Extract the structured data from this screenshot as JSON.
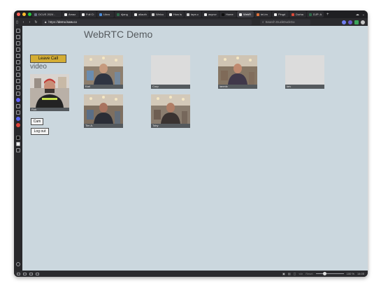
{
  "browser": {
    "tabs": [
      {
        "label": "DCUS 2024 -",
        "color": "#6a6f84",
        "active": false
      },
      {
        "label": "Amaz",
        "color": "#f0f0f0",
        "active": false
      },
      {
        "label": "Full Ci",
        "color": "#f0f0f0",
        "active": false
      },
      {
        "label": "Libra",
        "color": "#4a8ad6",
        "active": false
      },
      {
        "label": "djang",
        "color": "#2f6a4a",
        "active": false
      },
      {
        "label": "allauth",
        "color": "#f0f0f0",
        "active": false
      },
      {
        "label": "Welco",
        "color": "#cfcfcf",
        "active": false
      },
      {
        "label": "How is",
        "color": "#f0f0f0",
        "active": false
      },
      {
        "label": "tape-c",
        "color": "#cfcfcf",
        "active": false
      },
      {
        "label": "asyncr",
        "color": "#f0f0f0",
        "active": false
      },
      {
        "label": "Home",
        "color": "#111111",
        "active": false
      },
      {
        "label": "WebR",
        "color": "#f0f0f0",
        "active": true
      },
      {
        "label": "tel-im",
        "color": "#e0713a",
        "active": false
      },
      {
        "label": "Pingd",
        "color": "#f0f0f0",
        "active": false
      },
      {
        "label": "Durha",
        "color": "#d84a3a",
        "active": false
      },
      {
        "label": "DJP: A",
        "color": "#2f6a4a",
        "active": false
      }
    ],
    "new_tab": "+",
    "url_prefix": "https://",
    "url_host": "demo.kww.co",
    "search_placeholder": "Search DuckDuckGo",
    "zoom_level": "100 %",
    "clock": "14:05",
    "reset": "Reset"
  },
  "app": {
    "title": "WebRTC Demo",
    "leave_call": "Leave Call",
    "video_heading": "video",
    "self_label": "Rob",
    "cam_button": "Cam",
    "logout_button": "Log out"
  },
  "participants": [
    {
      "name": "Karl",
      "has_video": true,
      "row": 0,
      "col": 0
    },
    {
      "name": "Corp",
      "has_video": false,
      "row": 0,
      "col": 1
    },
    {
      "name": "ianedc",
      "has_video": true,
      "row": 0,
      "col": 2
    },
    {
      "name": "kev",
      "has_video": false,
      "row": 0,
      "col": 3
    },
    {
      "name": "Tim A.",
      "has_video": true,
      "row": 1,
      "col": 0
    },
    {
      "name": "Toby",
      "has_video": true,
      "row": 1,
      "col": 1
    }
  ],
  "colors": {
    "page_bg": "#cbd7de",
    "leave_button": "#d4ad34",
    "label_bar": "#555a5e",
    "browser_chrome": "#2b2b2e"
  }
}
